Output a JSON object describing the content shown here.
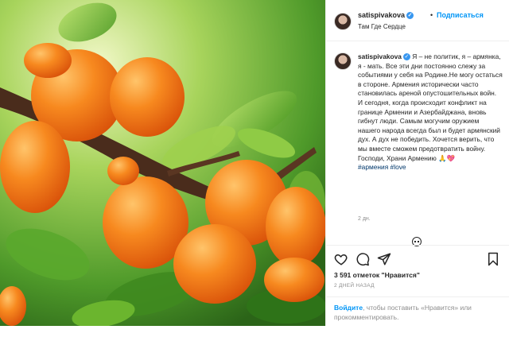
{
  "post": {
    "header": {
      "username": "satispivakova",
      "verified_icon": "verified-badge-icon",
      "separator": "•",
      "follow_label": "Подписаться",
      "location": "Там Где Сердце"
    },
    "caption": {
      "username": "satispivakova",
      "text": "Я – не политик, я – армянка, я - мать. Все эти дни постоянно слежу за событиями у себя на Родине.Не могу остаться в стороне. Армения исторически часто становилась ареной опустошительных войн. И сегодня, когда происходит конфликт на границе Армении и Азербайджана, вновь гибнут люди. Самым могучим оружием нашего народа всегда был и будет армянский дух. А дух не победить. Хочется верить, что мы вместе сможем предотвратить войну. Господи, Храни Армению ",
      "emoji": "🙏💖",
      "hashtags": "#армения #love",
      "time": "2 дн."
    },
    "actions": {
      "like_icon": "heart-icon",
      "comment_icon": "comment-icon",
      "share_icon": "share-icon",
      "save_icon": "bookmark-icon",
      "likes": "3 591 отметок \"Нравится\"",
      "date": "2 ДНЕЙ НАЗАД"
    },
    "login_prompt": {
      "link": "Войдите",
      "text": ", чтобы поставить «Нравится» или прокомментировать."
    }
  },
  "colors": {
    "link_blue": "#0095f6",
    "hashtag_blue": "#00376b",
    "secondary_text": "#8e8e8e",
    "apricot": "#f07a1c"
  }
}
